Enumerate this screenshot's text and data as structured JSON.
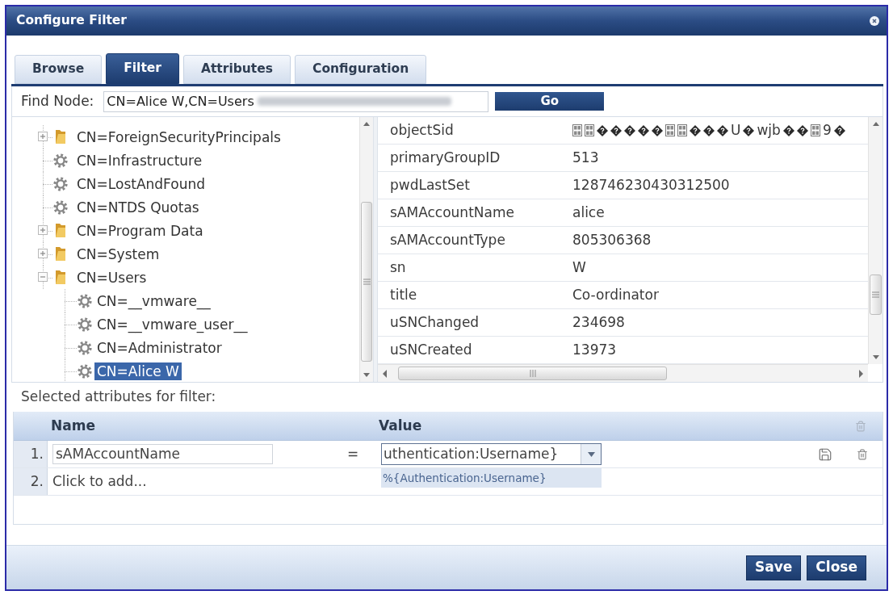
{
  "dialog": {
    "title": "Configure Filter"
  },
  "tabs": [
    {
      "label": "Browse",
      "selected": false
    },
    {
      "label": "Filter",
      "selected": true
    },
    {
      "label": "Attributes",
      "selected": false
    },
    {
      "label": "Configuration",
      "selected": false
    }
  ],
  "find_node": {
    "label": "Find Node:",
    "value": "CN=Alice W,CN=Users",
    "button": "Go"
  },
  "tree": {
    "items": [
      {
        "label": "CN=ForeignSecurityPrincipals",
        "kind": "folder",
        "expanded": false,
        "selected": false
      },
      {
        "label": "CN=Infrastructure",
        "kind": "object",
        "selected": false
      },
      {
        "label": "CN=LostAndFound",
        "kind": "object",
        "selected": false
      },
      {
        "label": "CN=NTDS Quotas",
        "kind": "object",
        "selected": false
      },
      {
        "label": "CN=Program Data",
        "kind": "folder",
        "expanded": false,
        "selected": false
      },
      {
        "label": "CN=System",
        "kind": "folder",
        "expanded": false,
        "selected": false
      },
      {
        "label": "CN=Users",
        "kind": "folder",
        "expanded": true,
        "selected": false,
        "children": [
          {
            "label": "CN=__vmware__",
            "kind": "object",
            "selected": false
          },
          {
            "label": "CN=__vmware_user__",
            "kind": "object",
            "selected": false
          },
          {
            "label": "CN=Administrator",
            "kind": "object",
            "selected": false
          },
          {
            "label": "CN=Alice W",
            "kind": "object",
            "selected": true
          }
        ]
      }
    ]
  },
  "attributes": {
    "rows": [
      {
        "name": "objectSid",
        "value_parts": [
          {
            "kind": "glyph_box"
          },
          {
            "kind": "glyph_box"
          },
          {
            "kind": "replacement_char"
          },
          {
            "kind": "replacement_char"
          },
          {
            "kind": "replacement_char"
          },
          {
            "kind": "replacement_char"
          },
          {
            "kind": "replacement_char"
          },
          {
            "kind": "glyph_box"
          },
          {
            "kind": "glyph_box"
          },
          {
            "kind": "replacement_char"
          },
          {
            "kind": "replacement_char"
          },
          {
            "kind": "replacement_char"
          },
          {
            "kind": "text",
            "text": "U"
          },
          {
            "kind": "replacement_char"
          },
          {
            "kind": "text",
            "text": "wjb"
          },
          {
            "kind": "replacement_char"
          },
          {
            "kind": "replacement_char"
          },
          {
            "kind": "glyph_box"
          },
          {
            "kind": "text",
            "text": "9"
          },
          {
            "kind": "replacement_char"
          }
        ]
      },
      {
        "name": "primaryGroupID",
        "value": "513"
      },
      {
        "name": "pwdLastSet",
        "value": "128746230430312500"
      },
      {
        "name": "sAMAccountName",
        "value": "alice"
      },
      {
        "name": "sAMAccountType",
        "value": "805306368"
      },
      {
        "name": "sn",
        "value": "W"
      },
      {
        "name": "title",
        "value": "Co-ordinator"
      },
      {
        "name": "uSNChanged",
        "value": "234698"
      },
      {
        "name": "uSNCreated",
        "value": "13973"
      }
    ]
  },
  "filter": {
    "label": "Selected attributes for filter:",
    "columns": [
      "Name",
      "Value"
    ],
    "delete_all_button": {
      "disabled": true
    },
    "rows": [
      {
        "index": "1.",
        "name": "sAMAccountName",
        "operator": "=",
        "value": "uthentication:Username}",
        "suggestions": [
          "%{Authentication:Username}"
        ]
      }
    ],
    "add_row": {
      "index": "2.",
      "text": "Click to add..."
    }
  },
  "buttons": [
    "Save",
    "Close"
  ]
}
